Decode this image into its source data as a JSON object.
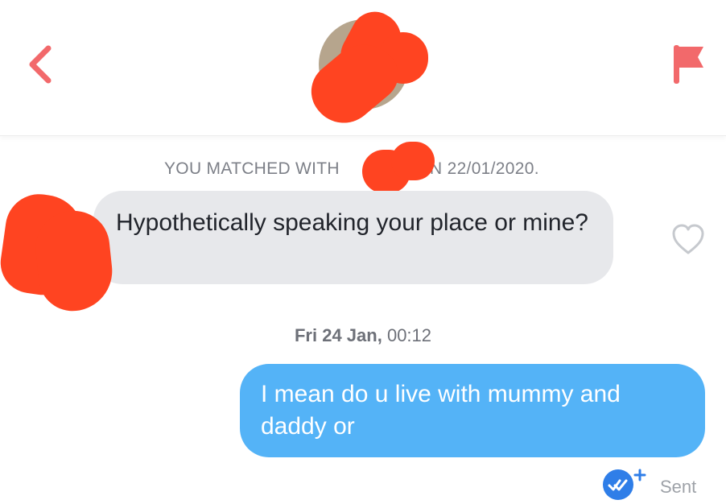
{
  "header": {
    "back_icon": "chevron-left-icon",
    "report_icon": "flag-icon",
    "accent_color": "#f2696b"
  },
  "match_banner": {
    "prefix": "YOU MATCHED WITH",
    "suffix": "N 22/01/2020."
  },
  "messages": [
    {
      "direction": "incoming",
      "text": "Hypothetically speaking your place or mine?",
      "reaction_icon": "heart-outline-icon",
      "bubble_color": "#e7e8eb"
    },
    {
      "direction": "outgoing",
      "text": "I mean do u live with mummy and daddy or",
      "bubble_color": "#54b3f7"
    }
  ],
  "timestamp": {
    "day": "Fri 24 Jan,",
    "time": "00:12"
  },
  "status": {
    "label": "Sent",
    "icon": "double-check-plus-icon",
    "icon_color": "#2f7ee8"
  },
  "redaction_color": "#ff4421"
}
